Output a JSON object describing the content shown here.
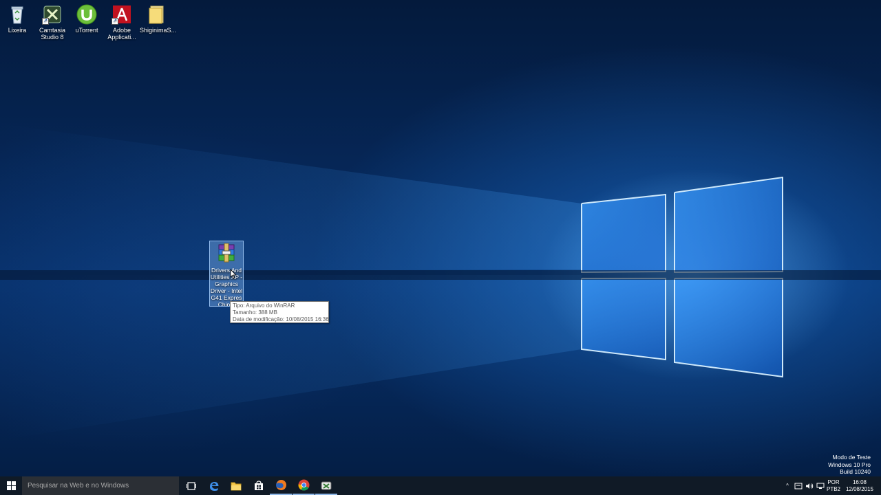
{
  "desktop_icons": [
    {
      "name": "recycle-bin",
      "label": "Lixeira",
      "icon": "recycle-bin-icon"
    },
    {
      "name": "camtasia",
      "label": "Camtasia\nStudio 8",
      "icon": "camtasia-icon"
    },
    {
      "name": "utorrent",
      "label": "uTorrent",
      "icon": "utorrent-icon"
    },
    {
      "name": "adobe",
      "label": "Adobe\nApplicati...",
      "icon": "adobe-icon"
    },
    {
      "name": "shiginima",
      "label": "ShiginimaS...",
      "icon": "folder-icon"
    }
  ],
  "selected_file": {
    "label": "Drivers And\nUtilities XP -\nGraphics\nDriver - Intel\nG41 Expres\nChip...",
    "icon": "winrar-archive-icon"
  },
  "tooltip": {
    "type": "Tipo: Arquivo do WinRAR",
    "size": "Tamanho: 388 MB",
    "modified": "Data de modificação: 10/08/2015 16:36"
  },
  "watermark": {
    "line1": "Modo de Teste",
    "line2": "Windows 10 Pro",
    "line3": "Build 10240"
  },
  "taskbar": {
    "search_placeholder": "Pesquisar na Web e no Windows",
    "apps": [
      "task-view-icon",
      "edge-icon",
      "file-explorer-icon",
      "store-icon",
      "firefox-icon",
      "chrome-icon",
      "camtasia-icon"
    ],
    "lang_top": "POR",
    "lang_bottom": "PTB2",
    "time": "16:08",
    "date": "12/08/2015"
  },
  "colors": {
    "taskbar": "#101a26",
    "search_box": "#2b2f35",
    "accent": "#1e78dc"
  }
}
